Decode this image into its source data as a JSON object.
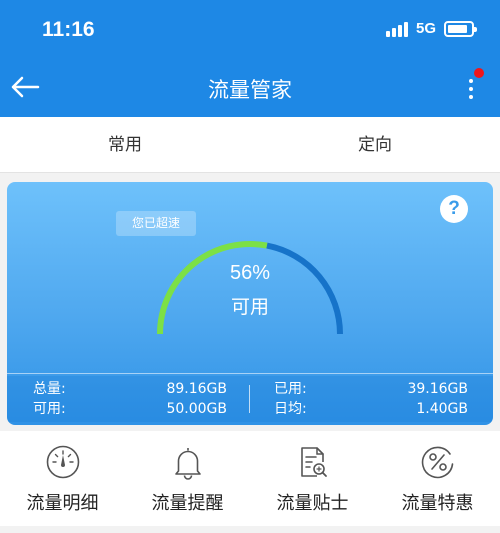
{
  "status_bar": {
    "time": "11:16",
    "network": "5G",
    "battery_level": 0.85
  },
  "app_bar": {
    "title": "流量管家",
    "back_icon": "arrow-left-icon",
    "more_icon": "more-vertical-icon",
    "badge_color": "#f0151b"
  },
  "tabs": [
    {
      "label": "常用",
      "active": true
    },
    {
      "label": "定向",
      "active": false
    }
  ],
  "summary": {
    "speed_badge": "您已超速",
    "percent": "56%",
    "percent_value": 0.56,
    "percent_label": "可用",
    "help_icon": "question-icon",
    "stats": {
      "total_label": "总量:",
      "total_value": "89.16GB",
      "available_label": "可用:",
      "available_value": "50.00GB",
      "used_label": "已用:",
      "used_value": "39.16GB",
      "daily_label": "日均:",
      "daily_value": "1.40GB"
    }
  },
  "menu": [
    {
      "label": "流量明细",
      "icon": "gauge-icon"
    },
    {
      "label": "流量提醒",
      "icon": "bell-icon"
    },
    {
      "label": "流量贴士",
      "icon": "document-search-icon"
    },
    {
      "label": "流量特惠",
      "icon": "percent-icon"
    }
  ],
  "colors": {
    "primary": "#1e88e5",
    "gauge_green": "#7ce046",
    "gauge_blue": "#1673c9"
  }
}
